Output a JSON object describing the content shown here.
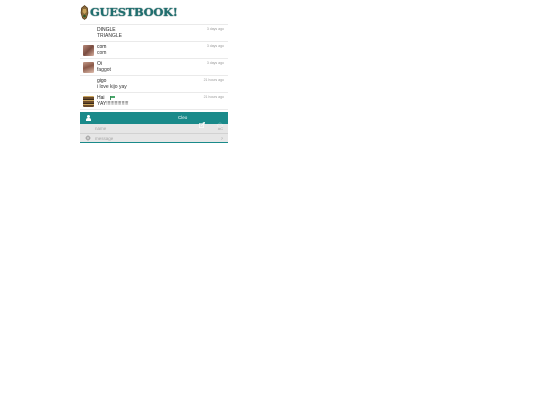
{
  "header": {
    "logo_text": "GUESTBOOK!"
  },
  "messages": [
    {
      "name": "DINGLE",
      "text": "TRIANGLE",
      "time": "3 days ago",
      "avatar": "none",
      "flag": false
    },
    {
      "name": "com",
      "text": "com",
      "time": "3 days ago",
      "avatar": "photo-avatar",
      "flag": false
    },
    {
      "name": "Oi",
      "text": "faggot",
      "time": "3 days ago",
      "avatar": "photo-avatar",
      "flag": false
    },
    {
      "name": "gigo",
      "text": "i love kijo yay",
      "time": "21 hours ago",
      "avatar": "none",
      "flag": false
    },
    {
      "name": "Hai",
      "text": "YAY!!!!!!!!!!!!!!!!",
      "time": "21 hours ago",
      "avatar": "pixel-avatar",
      "flag": true
    }
  ],
  "toolbar": {
    "username": "Cleo",
    "icons": [
      "user-icon",
      "edit-icon",
      "power-icon"
    ],
    "color": "#1a8a8a"
  },
  "form": {
    "name_placeholder": "name",
    "name_tag": "#C",
    "message_placeholder": "message",
    "message_tag": "?",
    "icons": [
      "gear-icon"
    ]
  }
}
